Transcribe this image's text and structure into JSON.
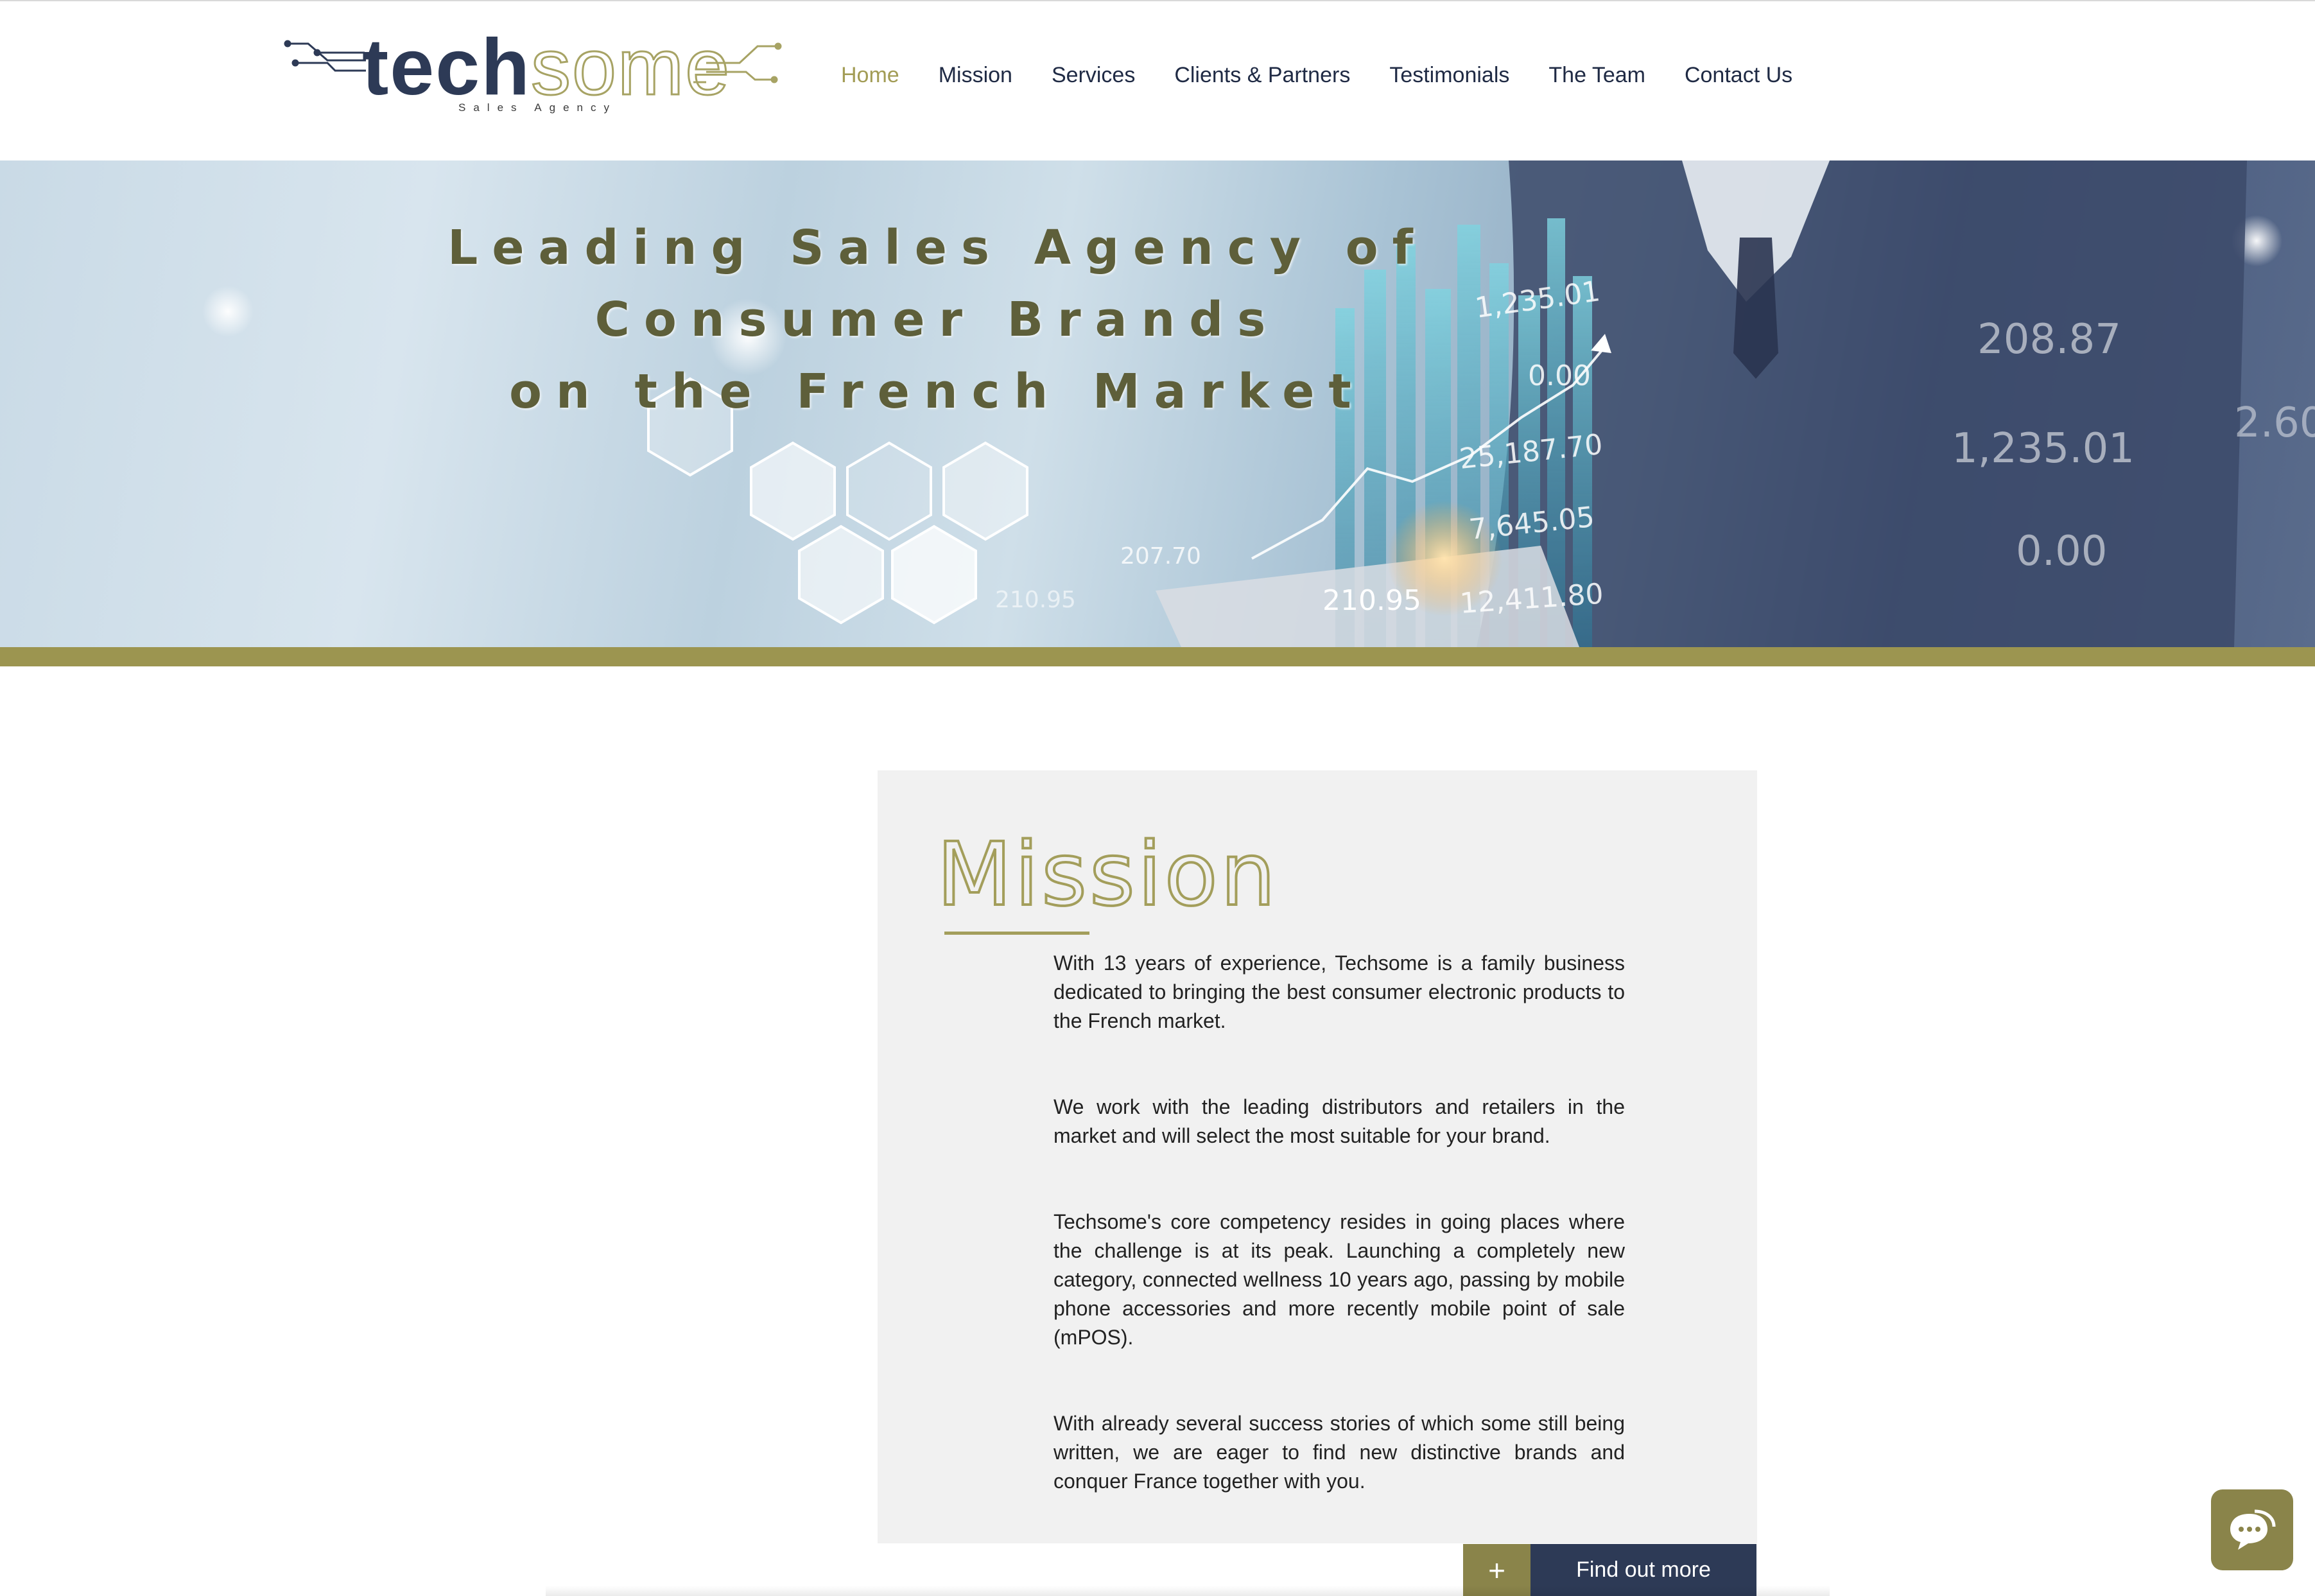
{
  "header": {
    "logo": {
      "primary": "tech",
      "secondary": "some",
      "tagline": "Sales Agency"
    },
    "nav": [
      {
        "label": "Home",
        "active": true
      },
      {
        "label": "Mission"
      },
      {
        "label": "Services"
      },
      {
        "label": "Clients & Partners"
      },
      {
        "label": "Testimonials"
      },
      {
        "label": "The Team"
      },
      {
        "label": "Contact Us"
      }
    ]
  },
  "hero": {
    "title_lines": [
      "Leading Sales Agency of",
      "Consumer Brands",
      "on the French Market"
    ],
    "figures": [
      "1,235.01",
      "0.00",
      "25,187.70",
      "7,645.05",
      "12,411.80",
      "210.95",
      "207.70",
      "210.95",
      "208.87",
      "1,235.01",
      "0.00",
      "2.60"
    ]
  },
  "mission": {
    "heading": "Mission",
    "paragraphs": [
      "With 13 years of experience, Techsome is a family business dedicated to bringing the best consumer electronic products to the French market.",
      "We work with the leading distributors and retailers in the market and will select the most suitable for your brand.",
      "Techsome's core competency resides in going places where the challenge is at its peak. Launching a completely new category, connected wellness 10 years ago, passing by mobile phone accessories and more recently mobile point of sale (mPOS).",
      "With already several success stories of which some still being written, we are eager to find new distinctive brands and conquer France together with you."
    ],
    "cta": {
      "icon": "+",
      "label": "Find out more"
    }
  },
  "chat": {
    "icon": "chat-bubble-icon"
  },
  "colors": {
    "accent": "#a29c55",
    "navy": "#2d3a56",
    "olive_bar": "#9c9550",
    "card_bg": "#f1f1f1"
  }
}
